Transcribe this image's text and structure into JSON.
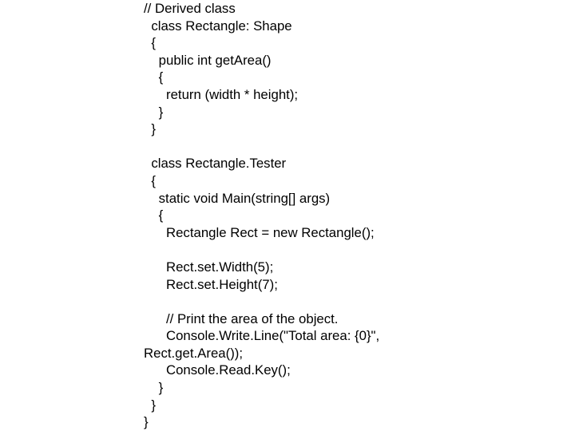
{
  "slide": {
    "background_color": "#ffffff",
    "text_color": "#000000",
    "title_comment": "// Derived class"
  },
  "code": {
    "language": "csharp",
    "lines": [
      "// Derived class",
      "  class Rectangle: Shape",
      "  {",
      "    public int getArea()",
      "    {",
      "      return (width * height);",
      "    }",
      "  }",
      "",
      "  class Rectangle.Tester",
      "  {",
      "    static void Main(string[] args)",
      "    {",
      "      Rectangle Rect = new Rectangle();",
      "",
      "      Rect.set.Width(5);",
      "      Rect.set.Height(7);",
      "",
      "      // Print the area of the object.",
      "      Console.Write.Line(\"Total area: {0}\", Rect.get.Area());",
      "      Console.Read.Key();",
      "    }",
      "  }",
      "}"
    ]
  }
}
